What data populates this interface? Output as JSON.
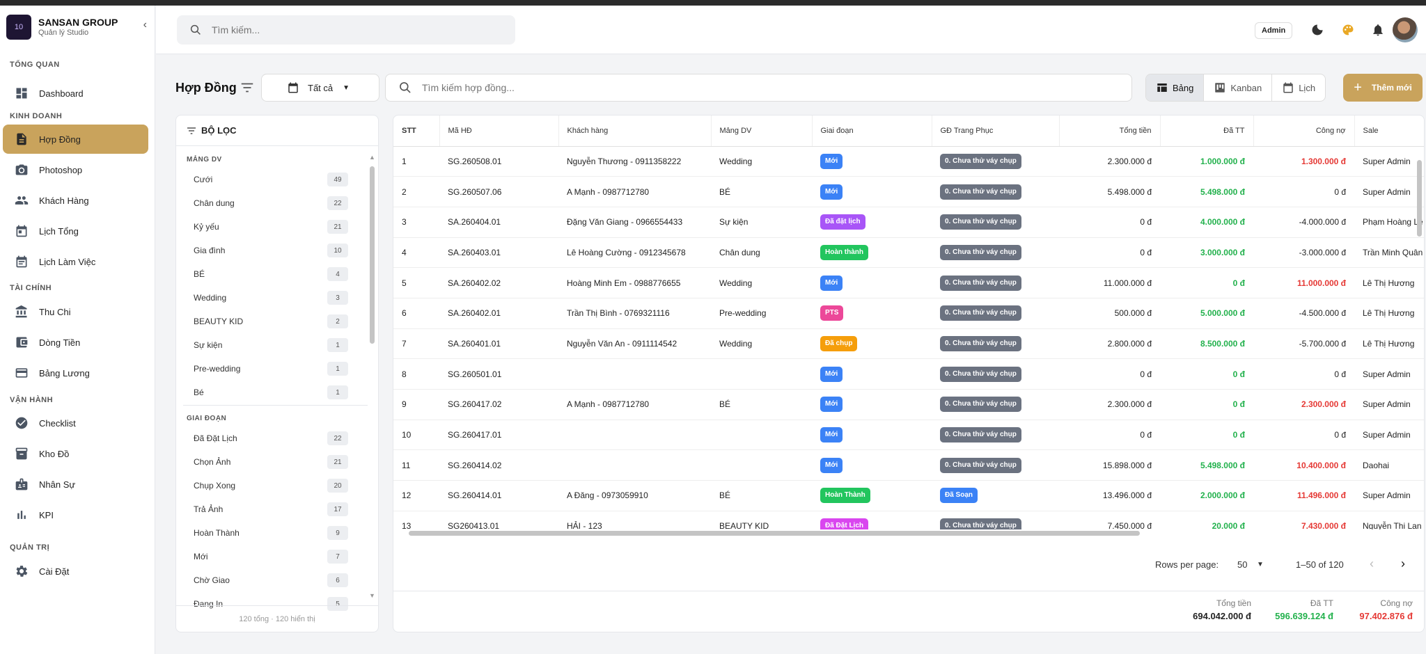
{
  "brand": {
    "name": "SANSAN GROUP",
    "subtitle": "Quản lý Studio",
    "logo_text": "10"
  },
  "sidebar": {
    "sections": {
      "overview": "TỔNG QUAN",
      "business": "KINH DOANH",
      "finance": "TÀI CHÍNH",
      "operations": "VẬN HÀNH",
      "admin": "QUẢN TRỊ"
    },
    "items": {
      "dashboard": "Dashboard",
      "contracts": "Hợp Đồng",
      "photoshop": "Photoshop",
      "customers": "Khách Hàng",
      "calendar": "Lịch Tổng",
      "workcal": "Lịch Làm Việc",
      "income": "Thu Chi",
      "cashflow": "Dòng Tiền",
      "payroll": "Bảng Lương",
      "checklist": "Checklist",
      "warehouse": "Kho Đồ",
      "staff": "Nhân Sự",
      "kpi": "KPI",
      "settings": "Cài Đặt"
    }
  },
  "header": {
    "search_placeholder": "Tìm kiếm...",
    "role_chip": "Admin"
  },
  "toolbar": {
    "title": "Hợp Đồng",
    "date_filter": "Tất cả",
    "search_placeholder": "Tìm kiếm hợp đồng...",
    "views": {
      "table": "Bảng",
      "kanban": "Kanban",
      "calendar": "Lịch"
    },
    "add_label": "Thêm mới"
  },
  "filter": {
    "title": "BỘ LỌC",
    "service_section": "MẢNG DV",
    "services": [
      {
        "label": "Cưới",
        "count": "49"
      },
      {
        "label": "Chân dung",
        "count": "22"
      },
      {
        "label": "Kỷ yếu",
        "count": "21"
      },
      {
        "label": "Gia đình",
        "count": "10"
      },
      {
        "label": "BÉ",
        "count": "4"
      },
      {
        "label": "Wedding",
        "count": "3"
      },
      {
        "label": "BEAUTY KID",
        "count": "2"
      },
      {
        "label": "Sự kiện",
        "count": "1"
      },
      {
        "label": "Pre-wedding",
        "count": "1"
      },
      {
        "label": "Bé",
        "count": "1"
      }
    ],
    "stage_section": "GIAI ĐOẠN",
    "stages": [
      {
        "label": "Đã Đặt Lịch",
        "count": "22"
      },
      {
        "label": "Chọn Ảnh",
        "count": "21"
      },
      {
        "label": "Chụp Xong",
        "count": "20"
      },
      {
        "label": "Trả Ảnh",
        "count": "17"
      },
      {
        "label": "Hoàn Thành",
        "count": "9"
      },
      {
        "label": "Mới",
        "count": "7"
      },
      {
        "label": "Chờ Giao",
        "count": "6"
      },
      {
        "label": "Đang In",
        "count": "5"
      }
    ],
    "footer": "120 tổng · 120 hiển thị"
  },
  "table": {
    "columns": {
      "stt": "STT",
      "code": "Mã HĐ",
      "customer": "Khách hàng",
      "service": "Mảng DV",
      "stage": "Giai đoạn",
      "costume": "GĐ Trang Phục",
      "total": "Tổng tiền",
      "paid": "Đã TT",
      "debt": "Công nợ",
      "sale": "Sale"
    },
    "rows": [
      {
        "stt": "1",
        "code": "SG.260508.01",
        "customer": "Nguyễn Thương - 0911358222",
        "service": "Wedding",
        "stage": "Mới",
        "stage_color": "#3b82f6",
        "costume": "0. Chưa thử váy chụp",
        "costume_color": "#6b7280",
        "total": "2.300.000 đ",
        "paid": "1.000.000 đ",
        "debt": "1.300.000 đ",
        "debt_red": true,
        "sale": "Super Admin"
      },
      {
        "stt": "2",
        "code": "SG.260507.06",
        "customer": "A Mạnh - 0987712780",
        "service": "BÉ",
        "stage": "Mới",
        "stage_color": "#3b82f6",
        "costume": "0. Chưa thử váy chụp",
        "costume_color": "#6b7280",
        "total": "5.498.000 đ",
        "paid": "5.498.000 đ",
        "debt": "0 đ",
        "debt_red": false,
        "sale": "Super Admin"
      },
      {
        "stt": "3",
        "code": "SA.260404.01",
        "customer": "Đặng Văn Giang - 0966554433",
        "service": "Sự kiện",
        "stage": "Đã đặt lịch",
        "stage_color": "#a855f7",
        "costume": "0. Chưa thử váy chụp",
        "costume_color": "#6b7280",
        "total": "0 đ",
        "paid": "4.000.000 đ",
        "debt": "-4.000.000 đ",
        "debt_red": false,
        "sale": "Phạm Hoàng Lê"
      },
      {
        "stt": "4",
        "code": "SA.260403.01",
        "customer": "Lê Hoàng Cường - 0912345678",
        "service": "Chân dung",
        "stage": "Hoàn thành",
        "stage_color": "#22c55e",
        "costume": "0. Chưa thử váy chụp",
        "costume_color": "#6b7280",
        "total": "0 đ",
        "paid": "3.000.000 đ",
        "debt": "-3.000.000 đ",
        "debt_red": false,
        "sale": "Trần Minh Quân"
      },
      {
        "stt": "5",
        "code": "SA.260402.02",
        "customer": "Hoàng Minh Em - 0988776655",
        "service": "Wedding",
        "stage": "Mới",
        "stage_color": "#3b82f6",
        "costume": "0. Chưa thử váy chụp",
        "costume_color": "#6b7280",
        "total": "11.000.000 đ",
        "paid": "0 đ",
        "debt": "11.000.000 đ",
        "debt_red": true,
        "sale": "Lê Thị Hương"
      },
      {
        "stt": "6",
        "code": "SA.260402.01",
        "customer": "Trần Thị Bình - 0769321116",
        "service": "Pre-wedding",
        "stage": "PTS",
        "stage_color": "#ec4899",
        "costume": "0. Chưa thử váy chụp",
        "costume_color": "#6b7280",
        "total": "500.000 đ",
        "paid": "5.000.000 đ",
        "debt": "-4.500.000 đ",
        "debt_red": false,
        "sale": "Lê Thị Hương"
      },
      {
        "stt": "7",
        "code": "SA.260401.01",
        "customer": "Nguyễn Văn An - 0911114542",
        "service": "Wedding",
        "stage": "Đã chụp",
        "stage_color": "#f59e0b",
        "costume": "0. Chưa thử váy chụp",
        "costume_color": "#6b7280",
        "total": "2.800.000 đ",
        "paid": "8.500.000 đ",
        "debt": "-5.700.000 đ",
        "debt_red": false,
        "sale": "Lê Thị Hương"
      },
      {
        "stt": "8",
        "code": "SG.260501.01",
        "customer": "",
        "service": "",
        "stage": "Mới",
        "stage_color": "#3b82f6",
        "costume": "0. Chưa thử váy chụp",
        "costume_color": "#6b7280",
        "total": "0 đ",
        "paid": "0 đ",
        "debt": "0 đ",
        "debt_red": false,
        "sale": "Super Admin"
      },
      {
        "stt": "9",
        "code": "SG.260417.02",
        "customer": "A Mạnh - 0987712780",
        "service": "BÉ",
        "stage": "Mới",
        "stage_color": "#3b82f6",
        "costume": "0. Chưa thử váy chụp",
        "costume_color": "#6b7280",
        "total": "2.300.000 đ",
        "paid": "0 đ",
        "debt": "2.300.000 đ",
        "debt_red": true,
        "sale": "Super Admin"
      },
      {
        "stt": "10",
        "code": "SG.260417.01",
        "customer": "",
        "service": "",
        "stage": "Mới",
        "stage_color": "#3b82f6",
        "costume": "0. Chưa thử váy chụp",
        "costume_color": "#6b7280",
        "total": "0 đ",
        "paid": "0 đ",
        "debt": "0 đ",
        "debt_red": false,
        "sale": "Super Admin"
      },
      {
        "stt": "11",
        "code": "SG.260414.02",
        "customer": "",
        "service": "",
        "stage": "Mới",
        "stage_color": "#3b82f6",
        "costume": "0. Chưa thử váy chụp",
        "costume_color": "#6b7280",
        "total": "15.898.000 đ",
        "paid": "5.498.000 đ",
        "debt": "10.400.000 đ",
        "debt_red": true,
        "sale": "Daohai"
      },
      {
        "stt": "12",
        "code": "SG.260414.01",
        "customer": "A Đăng - 0973059910",
        "service": "BÉ",
        "stage": "Hoàn Thành",
        "stage_color": "#22c55e",
        "costume": "Đã Soạn",
        "costume_color": "#3b82f6",
        "total": "13.496.000 đ",
        "paid": "2.000.000 đ",
        "debt": "11.496.000 đ",
        "debt_red": true,
        "sale": "Super Admin"
      },
      {
        "stt": "13",
        "code": "SG260413.01",
        "customer": "HẢI - 123",
        "service": "BEAUTY KID",
        "stage": "Đã Đặt Lịch",
        "stage_color": "#d946ef",
        "costume": "0. Chưa thử váy chụp",
        "costume_color": "#6b7280",
        "total": "7.450.000 đ",
        "paid": "20.000 đ",
        "debt": "7.430.000 đ",
        "debt_red": true,
        "sale": "Nguyễn Thị Lan"
      }
    ]
  },
  "pager": {
    "rows_label": "Rows per page:",
    "rows_value": "50",
    "range": "1–50 of 120"
  },
  "totals": {
    "total_label": "Tổng tiền",
    "total_value": "694.042.000 đ",
    "paid_label": "Đã TT",
    "paid_value": "596.639.124 đ",
    "debt_label": "Công nợ",
    "debt_value": "97.402.876 đ"
  }
}
